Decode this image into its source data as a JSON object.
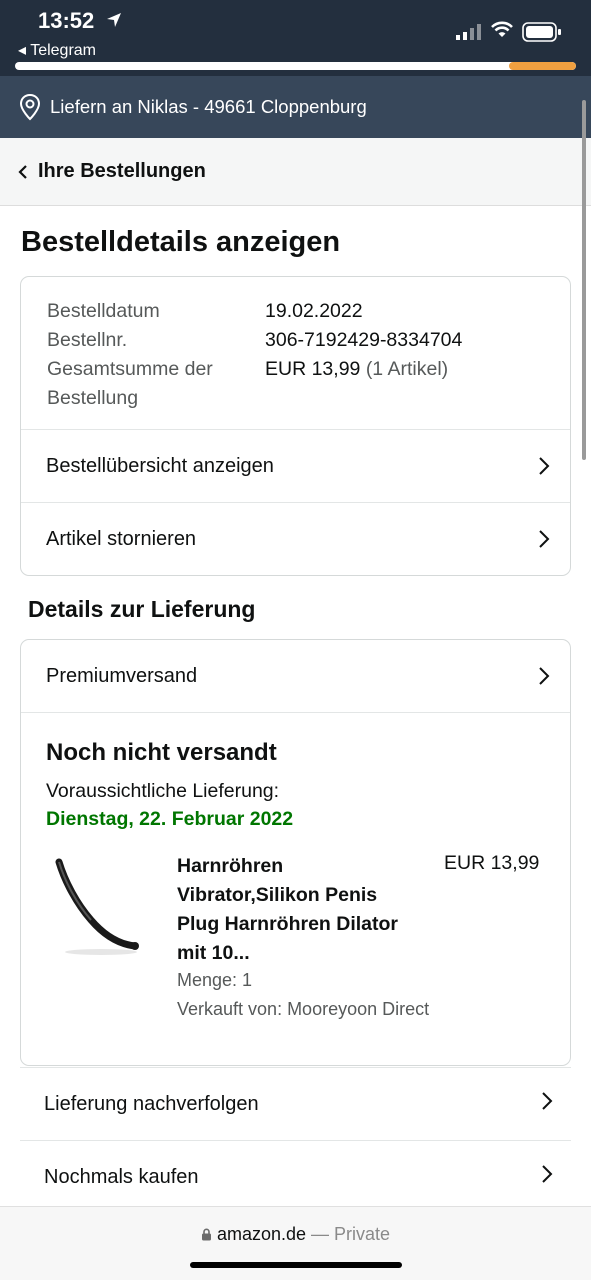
{
  "status_bar": {
    "time": "13:52",
    "back_app": "◂ Telegram",
    "load_progress": 0.12
  },
  "delivery": {
    "text": "Liefern an Niklas - 49661 Cloppenburg"
  },
  "breadcrumb": {
    "label": "Ihre Bestellungen"
  },
  "page_title": "Bestelldetails anzeigen",
  "order_info": {
    "date_label": "Bestelldatum",
    "date_value": "19.02.2022",
    "number_label": "Bestellnr.",
    "number_value": "306-7192429-8334704",
    "total_label_line1": "Gesamtsumme der",
    "total_label_line2": "Bestellung",
    "total_value": "EUR 13,99",
    "total_count": "(1 Artikel)"
  },
  "order_links": {
    "summary": "Bestellübersicht anzeigen",
    "cancel": "Artikel stornieren"
  },
  "delivery_details": {
    "section_title": "Details zur Lieferung",
    "shipping_method": "Premiumversand",
    "status": "Noch nicht versandt",
    "eta_label": "Voraussichtliche Lieferung:",
    "eta_date": "Dienstag, 22. Februar 2022"
  },
  "product": {
    "title": "Harnröhren Vibrator,Silikon Penis Plug Harnröhren Dilator mit 10...",
    "price": "EUR 13,99",
    "quantity": "Menge: 1",
    "seller": "Verkauft von: Mooreyoon Direct"
  },
  "actions": {
    "track": "Lieferung nachverfolgen",
    "buy_again": "Nochmals kaufen"
  },
  "browser": {
    "domain": "amazon.de",
    "mode": "— Private"
  },
  "colors": {
    "header_dark": "#232f3e",
    "delivery_bar": "#37475a",
    "eta_green": "#007600"
  }
}
